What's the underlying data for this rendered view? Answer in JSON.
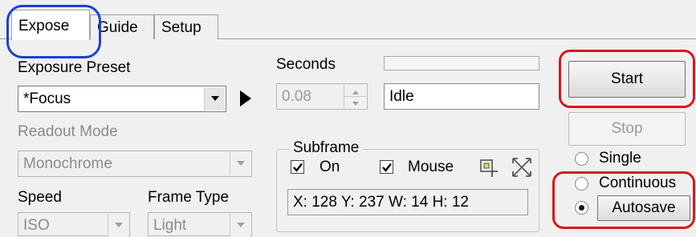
{
  "tabs": [
    {
      "label": "Expose",
      "active": true
    },
    {
      "label": "Guide",
      "active": false
    },
    {
      "label": "Setup",
      "active": false
    }
  ],
  "exposure_preset": {
    "label": "Exposure Preset",
    "value": "*Focus"
  },
  "readout_mode": {
    "label": "Readout Mode",
    "value": "Monochrome"
  },
  "speed": {
    "label": "Speed",
    "value": "ISO"
  },
  "frame_type": {
    "label": "Frame Type",
    "value": "Light"
  },
  "seconds": {
    "label": "Seconds",
    "value": "0.08"
  },
  "status": {
    "value": "Idle"
  },
  "subframe": {
    "title": "Subframe",
    "on": {
      "label": "On",
      "checked": true
    },
    "mouse": {
      "label": "Mouse",
      "checked": true
    },
    "info": "X: 128 Y: 237 W:  14 H:  12"
  },
  "buttons": {
    "start": "Start",
    "stop": "Stop"
  },
  "mode": {
    "options": [
      {
        "label": "Single",
        "selected": false
      },
      {
        "label": "Continuous",
        "selected": false
      }
    ],
    "autosave": {
      "label": "Autosave",
      "selected": true
    }
  },
  "colors": {
    "annotation_blue": "#1f3fd6",
    "annotation_red": "#d8171d"
  },
  "icons": [
    "dropdown-arrow-icon",
    "play-icon",
    "spin-up-icon",
    "spin-down-icon",
    "checkmark-icon",
    "select-subframe-icon",
    "fullframe-icon"
  ]
}
